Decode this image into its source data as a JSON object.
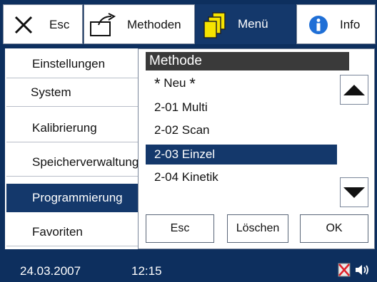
{
  "toolbar": {
    "esc_label": "Esc",
    "methods_label": "Methoden",
    "menu_label": "Menü",
    "info_label": "Info"
  },
  "sidebar": {
    "items": [
      {
        "label": "Einstellungen"
      },
      {
        "label": "System"
      },
      {
        "label": "Kalibrierung"
      },
      {
        "label": "Speicherverwaltung"
      },
      {
        "label": "Programmierung"
      },
      {
        "label": "Favoriten"
      }
    ],
    "selected": "Programmierung"
  },
  "dialog": {
    "title": "Methode",
    "new_label": "Neu",
    "methods": [
      {
        "code": "2-01",
        "name": "Multi"
      },
      {
        "code": "2-02",
        "name": "Scan"
      },
      {
        "code": "2-03",
        "name": "Einzel"
      },
      {
        "code": "2-04",
        "name": "Kinetik"
      }
    ],
    "selected_method": "2-03",
    "buttons": {
      "esc": "Esc",
      "delete": "Löschen",
      "ok": "OK"
    }
  },
  "status": {
    "date": "24.03.2007",
    "time": "12:15"
  },
  "colors": {
    "accent": "#14386b",
    "background": "#0d2f5e",
    "title_bar": "#3a3a3a"
  }
}
